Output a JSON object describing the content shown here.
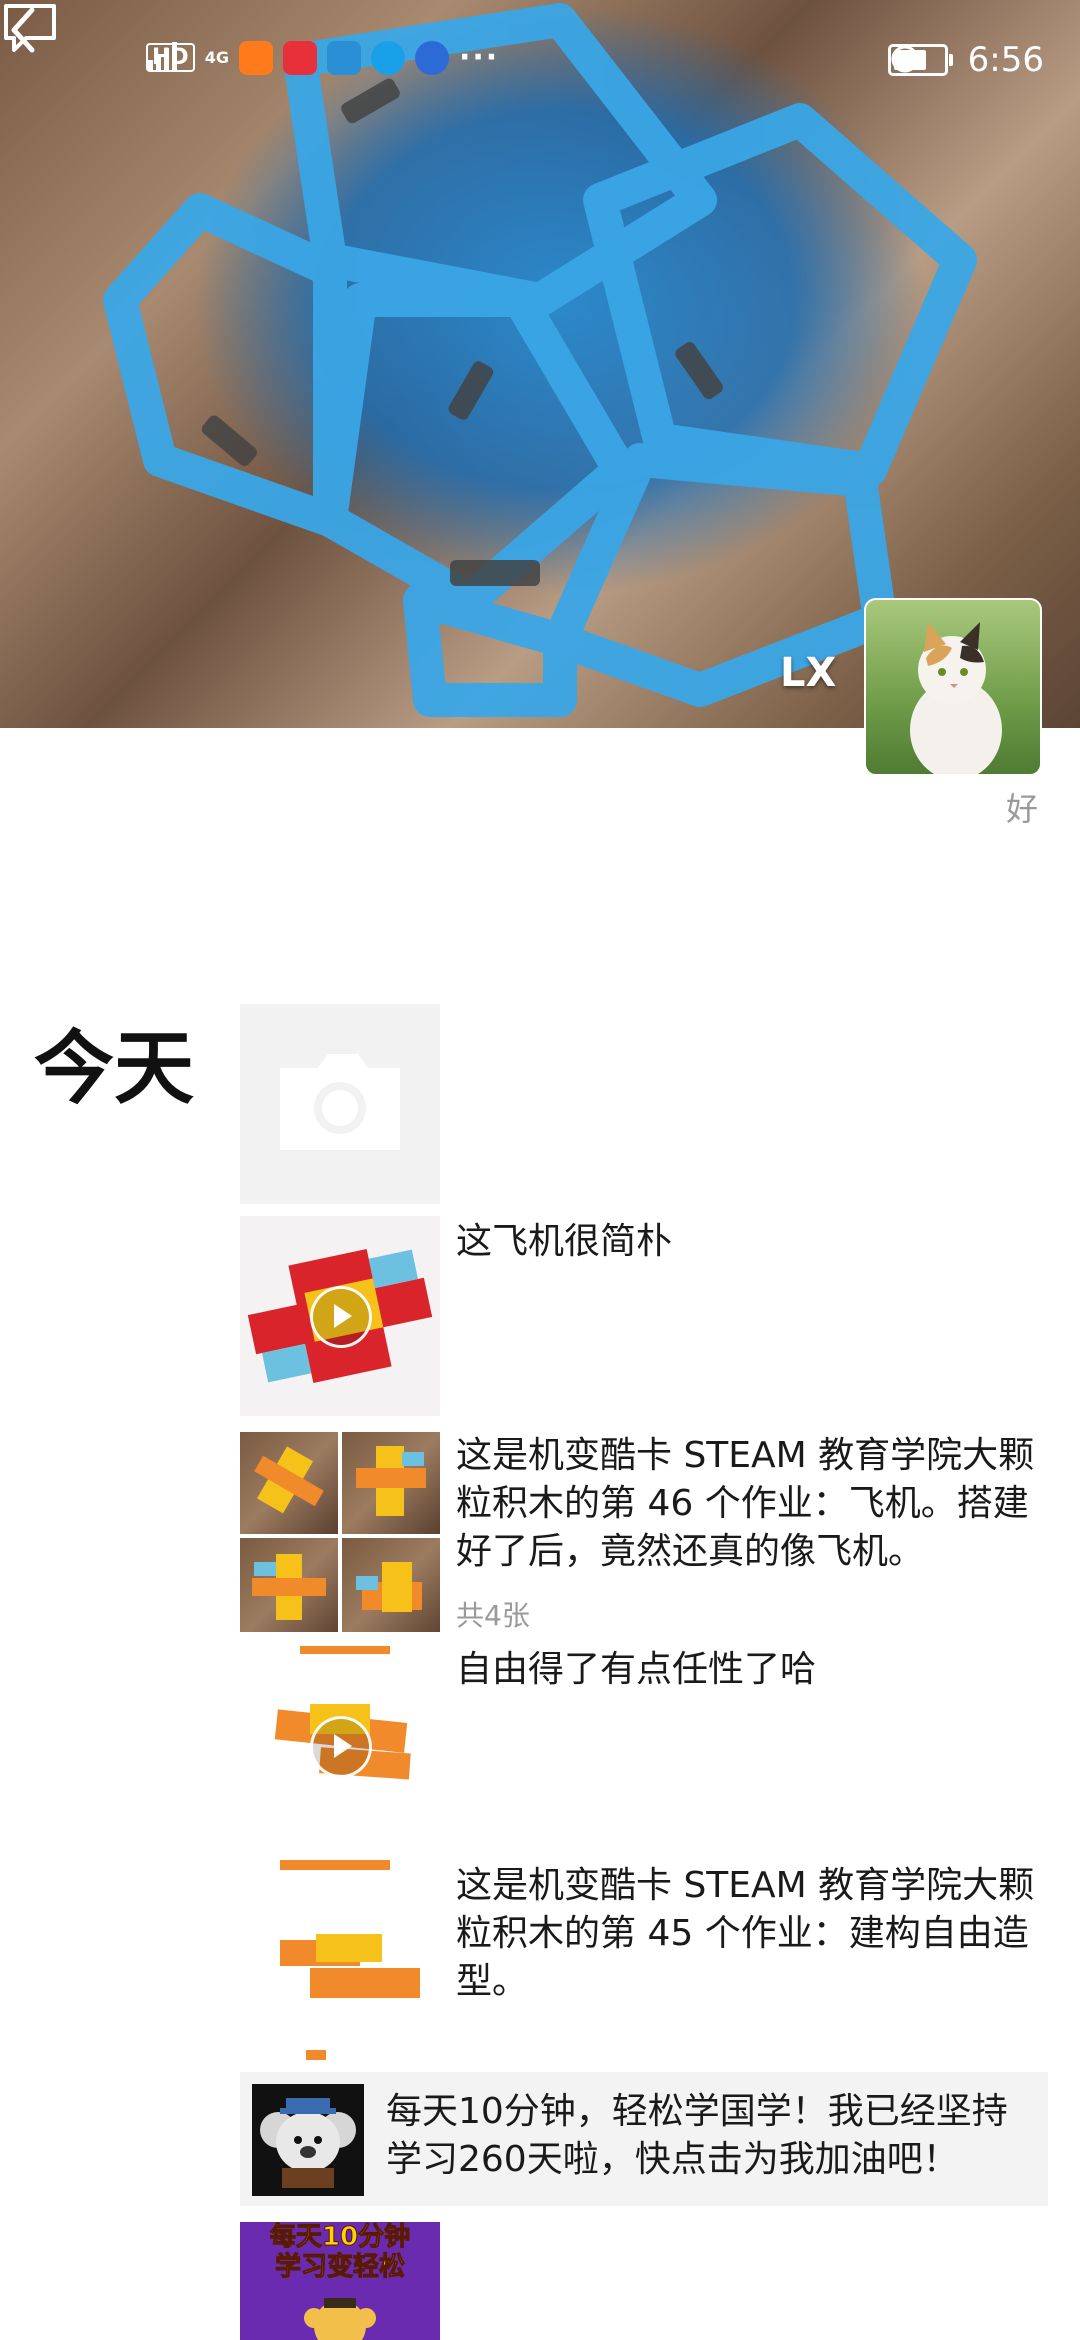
{
  "status_bar": {
    "hd": "HD",
    "network": "4G",
    "more": "···",
    "time": "6:56",
    "battery_level": 0.6
  },
  "header": {
    "username": "LX",
    "signature": "好"
  },
  "feed": {
    "date_label": "今天",
    "posts": [
      {
        "text": "这飞机很简朴",
        "media": "video"
      },
      {
        "text": "这是机变酷卡 STEAM 教育学院大颗粒积木的第 46 个作业：飞机。搭建好了后，竟然还真的像飞机。",
        "media": "photos",
        "count": "共4张"
      },
      {
        "text": "自由得了有点任性了哈",
        "media": "video"
      },
      {
        "text": "这是机变酷卡 STEAM 教育学院大颗粒积木的第 45 个作业：建构自由造型。",
        "media": "photo"
      }
    ],
    "shared": {
      "text": "每天10分钟，轻松学国学！我已经坚持学习260天啦，快点击为我加油吧！"
    },
    "bottom_thumb_text": "每天10分钟\n学习变轻松"
  },
  "colors": {
    "accent_blue": "#2a8fd4",
    "muted": "#9a9a9a"
  },
  "icons": [
    "back-arrow-icon",
    "comment-icon",
    "camera-icon",
    "play-icon",
    "alarm-icon",
    "battery-icon",
    "signal-icon"
  ]
}
